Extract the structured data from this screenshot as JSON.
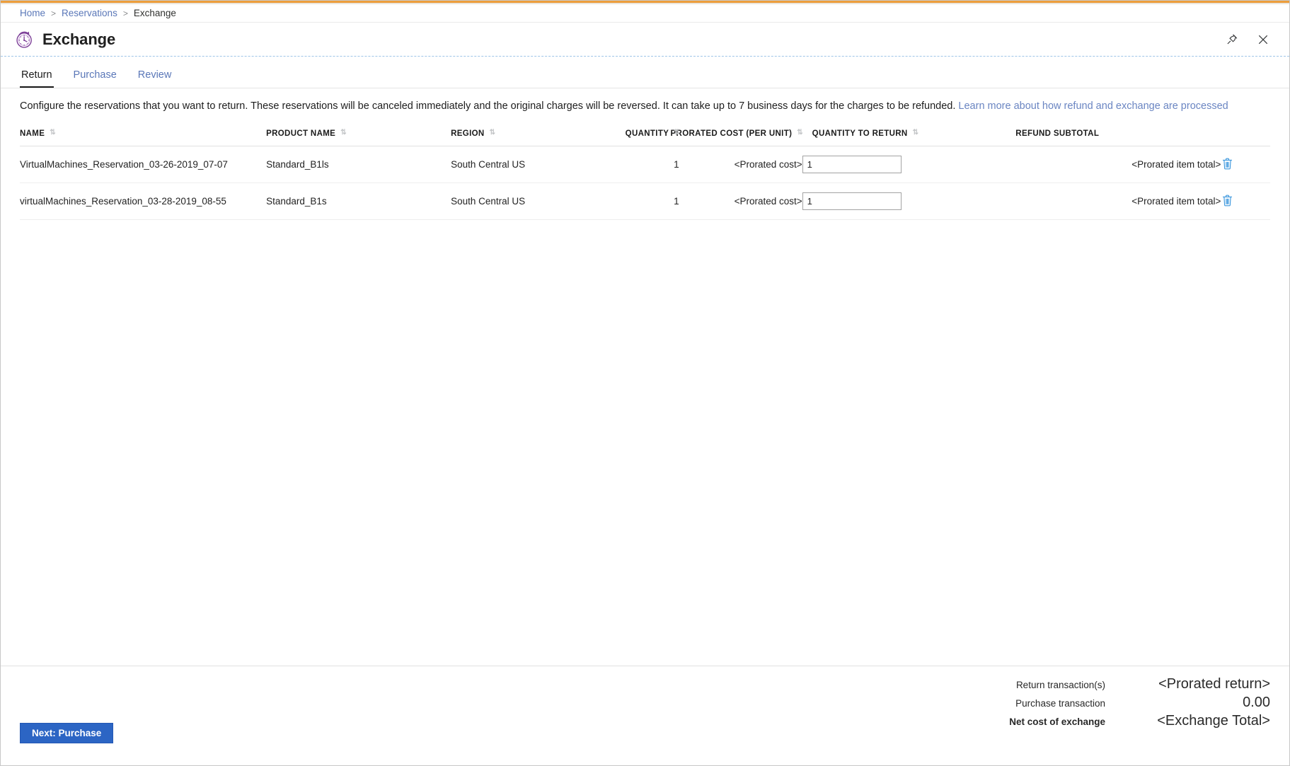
{
  "window": {
    "accent_color": "#e7983a",
    "pin_icon": "pin-icon",
    "close_icon": "close-icon"
  },
  "breadcrumb": {
    "items": [
      {
        "label": "Home",
        "link": true
      },
      {
        "label": "Reservations",
        "link": true
      },
      {
        "label": "Exchange",
        "link": false
      }
    ],
    "separator": ">"
  },
  "blade": {
    "title": "Exchange",
    "icon": "reservation-clock-icon",
    "icon_color": "#7d3f98"
  },
  "tabs": [
    {
      "label": "Return",
      "active": true
    },
    {
      "label": "Purchase",
      "active": false
    },
    {
      "label": "Review",
      "active": false
    }
  ],
  "description": {
    "text": "Configure the reservations that you want to return. These reservations will be canceled immediately and the original charges will be reversed. It can take up to 7 business days for the charges to be refunded. ",
    "link_text": "Learn more about how refund and exchange are processed",
    "link_color": "#6a85c2"
  },
  "table": {
    "columns": [
      {
        "key": "name",
        "label": "NAME",
        "sortable": true,
        "align": "left"
      },
      {
        "key": "product",
        "label": "PRODUCT NAME",
        "sortable": true,
        "align": "left"
      },
      {
        "key": "region",
        "label": "REGION",
        "sortable": true,
        "align": "left"
      },
      {
        "key": "quantity",
        "label": "QUANTITY",
        "sortable": true,
        "align": "right"
      },
      {
        "key": "cost",
        "label": "PRORATED COST (PER UNIT)",
        "sortable": true,
        "align": "right"
      },
      {
        "key": "qty_return",
        "label": "QUANTITY TO RETURN",
        "sortable": true,
        "align": "left"
      },
      {
        "key": "refund",
        "label": "REFUND SUBTOTAL",
        "sortable": false,
        "align": "left"
      }
    ],
    "rows": [
      {
        "name": "VirtualMachines_Reservation_03-26-2019_07-07",
        "product": "Standard_B1ls",
        "region": "South Central US",
        "quantity": "1",
        "cost": "<Prorated cost>",
        "qty_return": "1",
        "refund": "<Prorated item total>",
        "delete_icon": "trash-icon"
      },
      {
        "name": "virtualMachines_Reservation_03-28-2019_08-55",
        "product": "Standard_B1s",
        "region": "South Central US",
        "quantity": "1",
        "cost": "<Prorated cost>",
        "qty_return": "1",
        "refund": "<Prorated item total>",
        "delete_icon": "trash-icon"
      }
    ]
  },
  "footer": {
    "totals": [
      {
        "label": "Return transaction(s)",
        "value": "<Prorated return>",
        "bold": false
      },
      {
        "label": "Purchase transaction",
        "value": "0.00",
        "bold": false
      },
      {
        "label": "Net cost of exchange",
        "value": "<Exchange Total>",
        "bold": true
      }
    ],
    "next_button": "Next: Purchase",
    "next_button_color": "#2c65c4"
  }
}
